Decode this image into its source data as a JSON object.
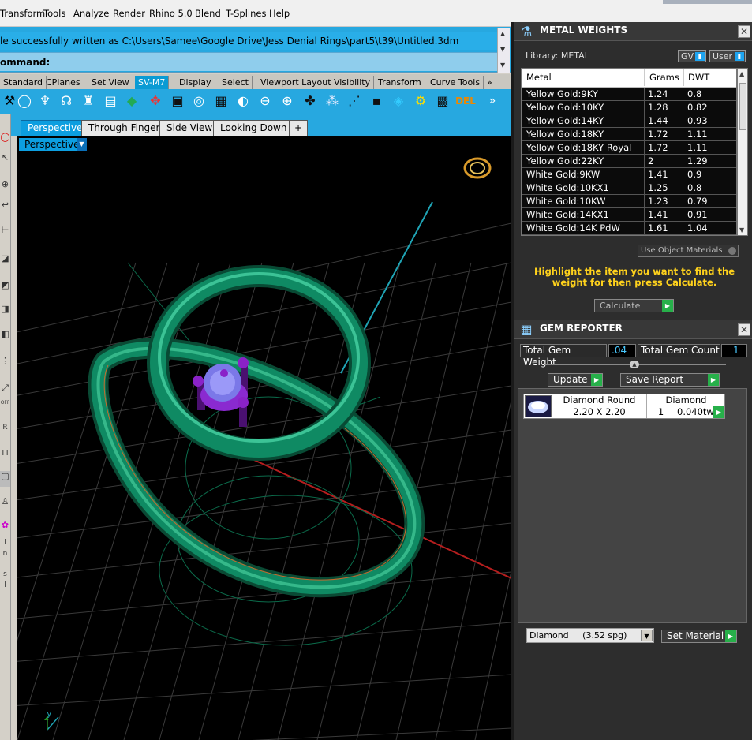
{
  "menu": [
    "Transform",
    "Tools",
    "Analyze",
    "Render",
    "Rhino 5.0",
    "Blend",
    "T-Splines",
    "Help"
  ],
  "command": {
    "history_line": "le successfully written as C:\\Users\\Samee\\Google Drive\\Jess Denial Rings\\part5\\t39\\Untitled.3dm",
    "prompt": "ommand:"
  },
  "toolbar_tabs": [
    "Standard",
    "CPlanes",
    "Set View",
    "SV-M7",
    "Display",
    "Select",
    "Viewport Layout",
    "Visibility",
    "Transform",
    "Curve Tools"
  ],
  "toolbar_tabs_more": "»",
  "toolbar_more": "»",
  "viewport_tabs": [
    "Perspective",
    "Through Finger",
    "Side View",
    "Looking Down"
  ],
  "viewport_add": "+",
  "viewport_label": "Perspective",
  "viewport_axes": {
    "z": "z",
    "y": "y"
  },
  "left_toolbar_text": {
    "off": "OFF",
    "r": "R",
    "l1": "l",
    "n": "n",
    "s": "s",
    "l2": "l"
  },
  "metal_weights": {
    "title": "METAL WEIGHTS",
    "library_label": "Library: METAL",
    "gv_label": "GV",
    "user_label": "User",
    "columns": [
      "Metal",
      "Grams",
      "DWT"
    ],
    "rows": [
      [
        "Yellow Gold:9KY",
        "1.24",
        "0.8"
      ],
      [
        "Yellow Gold:10KY",
        "1.28",
        "0.82"
      ],
      [
        "Yellow Gold:14KY",
        "1.44",
        "0.93"
      ],
      [
        "Yellow Gold:18KY",
        "1.72",
        "1.11"
      ],
      [
        "Yellow Gold:18KY Royal",
        "1.72",
        "1.11"
      ],
      [
        "Yellow Gold:22KY",
        "2",
        "1.29"
      ],
      [
        "White Gold:9KW",
        "1.41",
        "0.9"
      ],
      [
        "White Gold:10KX1",
        "1.25",
        "0.8"
      ],
      [
        "White Gold:10KW",
        "1.23",
        "0.79"
      ],
      [
        "White Gold:14KX1",
        "1.41",
        "0.91"
      ],
      [
        "White Gold:14K PdW",
        "1.61",
        "1.04"
      ]
    ],
    "use_object_materials": "Use Object Materials",
    "highlight_text": "Highlight the item you want to find the weight for then press Calculate.",
    "calculate_label": "Calculate"
  },
  "gem_reporter": {
    "title": "GEM REPORTER",
    "total_weight_label": "Total Gem Weight",
    "total_weight_value": ".04",
    "total_count_label": "Total Gem Count",
    "total_count_value": "1",
    "update_label": "Update",
    "save_report_label": "Save Report",
    "gem": {
      "shape": "Diamond Round",
      "size": "2.20 X 2.20",
      "material": "Diamond",
      "count": "1",
      "weight": "0.040tw"
    },
    "material_select": "Diamond     (3.52 spg)",
    "set_material_label": "Set Material"
  },
  "colors": {
    "accent": "#27a8e0",
    "ring": "#0f8a63",
    "gem": "#7b78e8",
    "prongs": "#6a1a9a",
    "highlight": "#ffd21c"
  }
}
